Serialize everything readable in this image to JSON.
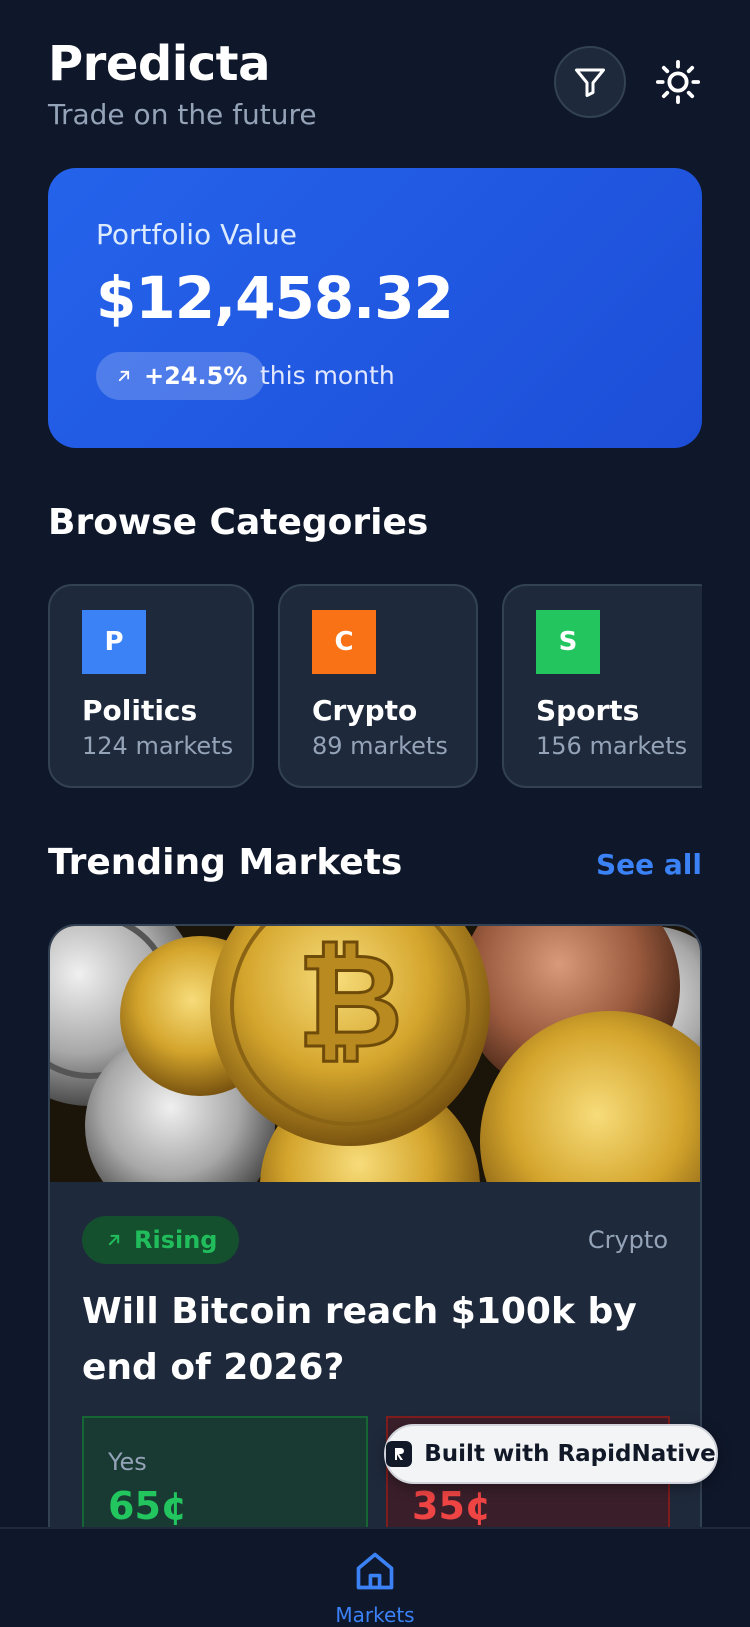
{
  "header": {
    "app_name": "Predicta",
    "tagline": "Trade on the future"
  },
  "portfolio": {
    "label": "Portfolio Value",
    "value": "$12,458.32",
    "change": "+24.5%",
    "period": "this month"
  },
  "categories": {
    "title": "Browse Categories",
    "items": [
      {
        "letter": "P",
        "name": "Politics",
        "count": "124 markets",
        "color": "#3b82f6"
      },
      {
        "letter": "C",
        "name": "Crypto",
        "count": "89 markets",
        "color": "#f97316"
      },
      {
        "letter": "S",
        "name": "Sports",
        "count": "156 markets",
        "color": "#22c55e"
      }
    ]
  },
  "trending": {
    "title": "Trending Markets",
    "see_all": "See all",
    "market": {
      "status": "Rising",
      "category": "Crypto",
      "question": "Will Bitcoin reach $100k by end of 2026?",
      "yes_label": "Yes",
      "yes_price": "65¢",
      "no_price": "35¢"
    }
  },
  "badge": {
    "text": "Built with RapidNative"
  },
  "nav": {
    "home_label": "Markets"
  },
  "colors": {
    "background": "#0f172a",
    "card": "#1e293b",
    "accent": "#3b82f6",
    "yes": "#22c55e",
    "no": "#ef4444"
  }
}
